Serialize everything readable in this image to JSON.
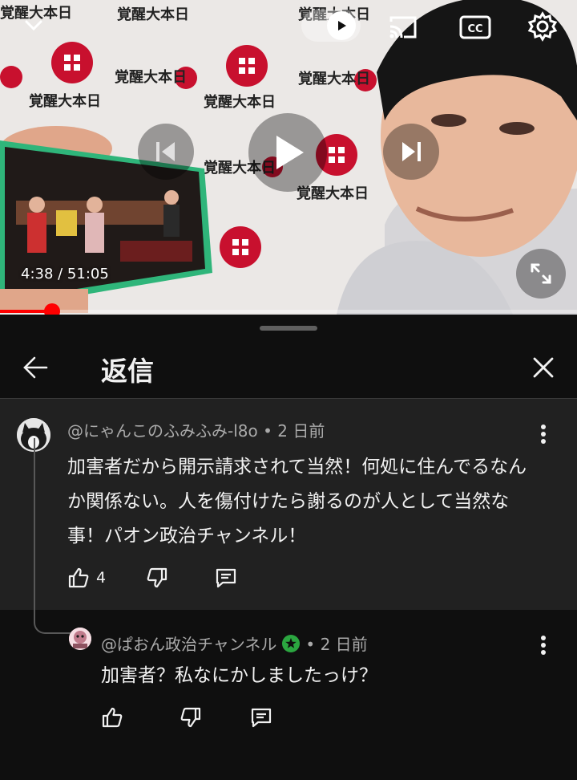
{
  "player": {
    "current_time": "4:38",
    "duration": "51:05",
    "time_display": "4:38 / 51:05",
    "progress_fraction": 0.0907,
    "backdrop_text": "覚醒大本日",
    "icons": [
      "chevron-down-icon",
      "autoplay-toggle-icon",
      "cast-icon",
      "captions-icon",
      "settings-icon",
      "previous-icon",
      "play-icon",
      "next-icon",
      "fullscreen-icon"
    ],
    "colors": {
      "progress": "#ff0000",
      "logo": "#c8102e"
    }
  },
  "sheet": {
    "title": "返信",
    "icons": [
      "back-arrow-icon",
      "close-icon"
    ]
  },
  "parent_comment": {
    "author": "@にゃんこのふみふみ-l8o",
    "age": "2 日前",
    "text": "加害者だから開示請求されて当然！何処に住んでるなんか関係ない。人を傷付けたら謝るのが人として当然な事！パオン政治チャンネル！",
    "likes": "4",
    "icons": [
      "like-icon",
      "dislike-icon",
      "reply-icon",
      "more-vert-icon"
    ]
  },
  "reply_comment": {
    "author": "@ぱおん政治チャンネル",
    "age": "2 日前",
    "text": "加害者？私なにかしましたっけ？",
    "badge_icon": "verified-star-icon",
    "badge_color": "#2ba640",
    "icons": [
      "like-icon",
      "dislike-icon",
      "reply-icon",
      "more-vert-icon"
    ]
  }
}
